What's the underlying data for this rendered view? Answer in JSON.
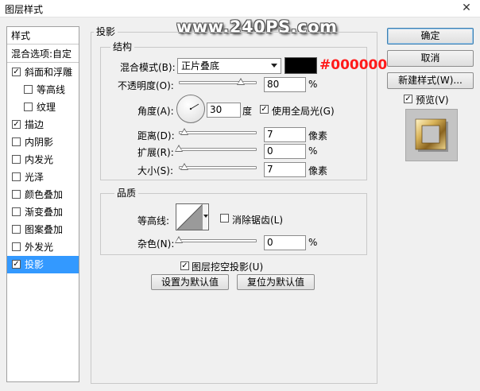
{
  "window": {
    "title": "图层样式",
    "close_glyph": "✕"
  },
  "watermark": "www.240PS.com",
  "left_panel": {
    "header": "样式",
    "blend_options": "混合选项:自定",
    "items": [
      {
        "label": "斜面和浮雕",
        "checked": true,
        "sub": false,
        "selected": false
      },
      {
        "label": "等高线",
        "checked": false,
        "sub": true,
        "selected": false
      },
      {
        "label": "纹理",
        "checked": false,
        "sub": true,
        "selected": false
      },
      {
        "label": "描边",
        "checked": true,
        "sub": false,
        "selected": false
      },
      {
        "label": "内阴影",
        "checked": false,
        "sub": false,
        "selected": false
      },
      {
        "label": "内发光",
        "checked": false,
        "sub": false,
        "selected": false
      },
      {
        "label": "光泽",
        "checked": false,
        "sub": false,
        "selected": false
      },
      {
        "label": "颜色叠加",
        "checked": false,
        "sub": false,
        "selected": false
      },
      {
        "label": "渐变叠加",
        "checked": false,
        "sub": false,
        "selected": false
      },
      {
        "label": "图案叠加",
        "checked": false,
        "sub": false,
        "selected": false
      },
      {
        "label": "外发光",
        "checked": false,
        "sub": false,
        "selected": false
      },
      {
        "label": "投影",
        "checked": true,
        "sub": false,
        "selected": true
      }
    ]
  },
  "drop_shadow": {
    "title": "投影",
    "structure": {
      "title": "结构",
      "blend_mode_label": "混合模式(B):",
      "blend_mode_value": "正片叠底",
      "color_hex": "#000000",
      "color_label": "#000000",
      "opacity_label": "不透明度(O):",
      "opacity_value": "80",
      "opacity_unit": "%",
      "angle_label": "角度(A):",
      "angle_value": "30",
      "angle_unit": "度",
      "global_light_label": "使用全局光(G)",
      "global_light_checked": true,
      "distance_label": "距离(D):",
      "distance_value": "7",
      "distance_unit": "像素",
      "spread_label": "扩展(R):",
      "spread_value": "0",
      "spread_unit": "%",
      "size_label": "大小(S):",
      "size_value": "7",
      "size_unit": "像素"
    },
    "quality": {
      "title": "品质",
      "contour_label": "等高线:",
      "anti_alias_label": "消除锯齿(L)",
      "anti_alias_checked": false,
      "noise_label": "杂色(N):",
      "noise_value": "0",
      "noise_unit": "%"
    },
    "knockout_label": "图层挖空投影(U)",
    "knockout_checked": true,
    "make_default_label": "设置为默认值",
    "reset_default_label": "复位为默认值"
  },
  "right_panel": {
    "ok_label": "确定",
    "cancel_label": "取消",
    "new_style_label": "新建样式(W)...",
    "preview_label": "预览(V)",
    "preview_checked": true
  },
  "check_glyph": "✓"
}
